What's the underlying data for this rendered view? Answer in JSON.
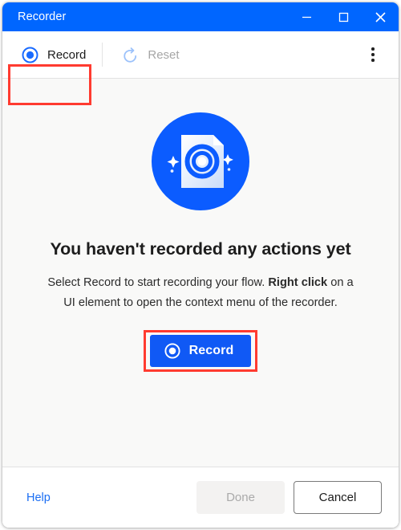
{
  "window": {
    "title": "Recorder",
    "caption_buttons": [
      {
        "name": "minimize",
        "glyph": "minimize-icon"
      },
      {
        "name": "maximize",
        "glyph": "maximize-icon"
      },
      {
        "name": "close",
        "glyph": "close-icon"
      }
    ]
  },
  "toolbar": {
    "record_label": "Record",
    "record_icon": "record-circle-icon",
    "reset_label": "Reset",
    "reset_icon": "reset-undo-icon",
    "reset_disabled": true,
    "more_icon": "more-vertical-icon"
  },
  "main": {
    "hero_icon": "document-record-icon",
    "headline": "You haven't recorded any actions yet",
    "body_line1": "Select Record to start recording your flow.",
    "body_bold": "Right click",
    "body_line2_rest": " on a UI element to open the context",
    "body_line3": "menu of the recorder.",
    "primary_button_label": "Record",
    "primary_button_icon": "record-circle-icon"
  },
  "footer": {
    "help_label": "Help",
    "done_label": "Done",
    "done_disabled": true,
    "cancel_label": "Cancel"
  },
  "colors": {
    "titlebar_blue": "#0066FF",
    "accent_blue": "#1059F5",
    "hero_blue": "#0B5CFF",
    "annotation_red": "#FF3B30",
    "content_bg": "#F9F9F8",
    "link_blue": "#1B6EF3"
  }
}
